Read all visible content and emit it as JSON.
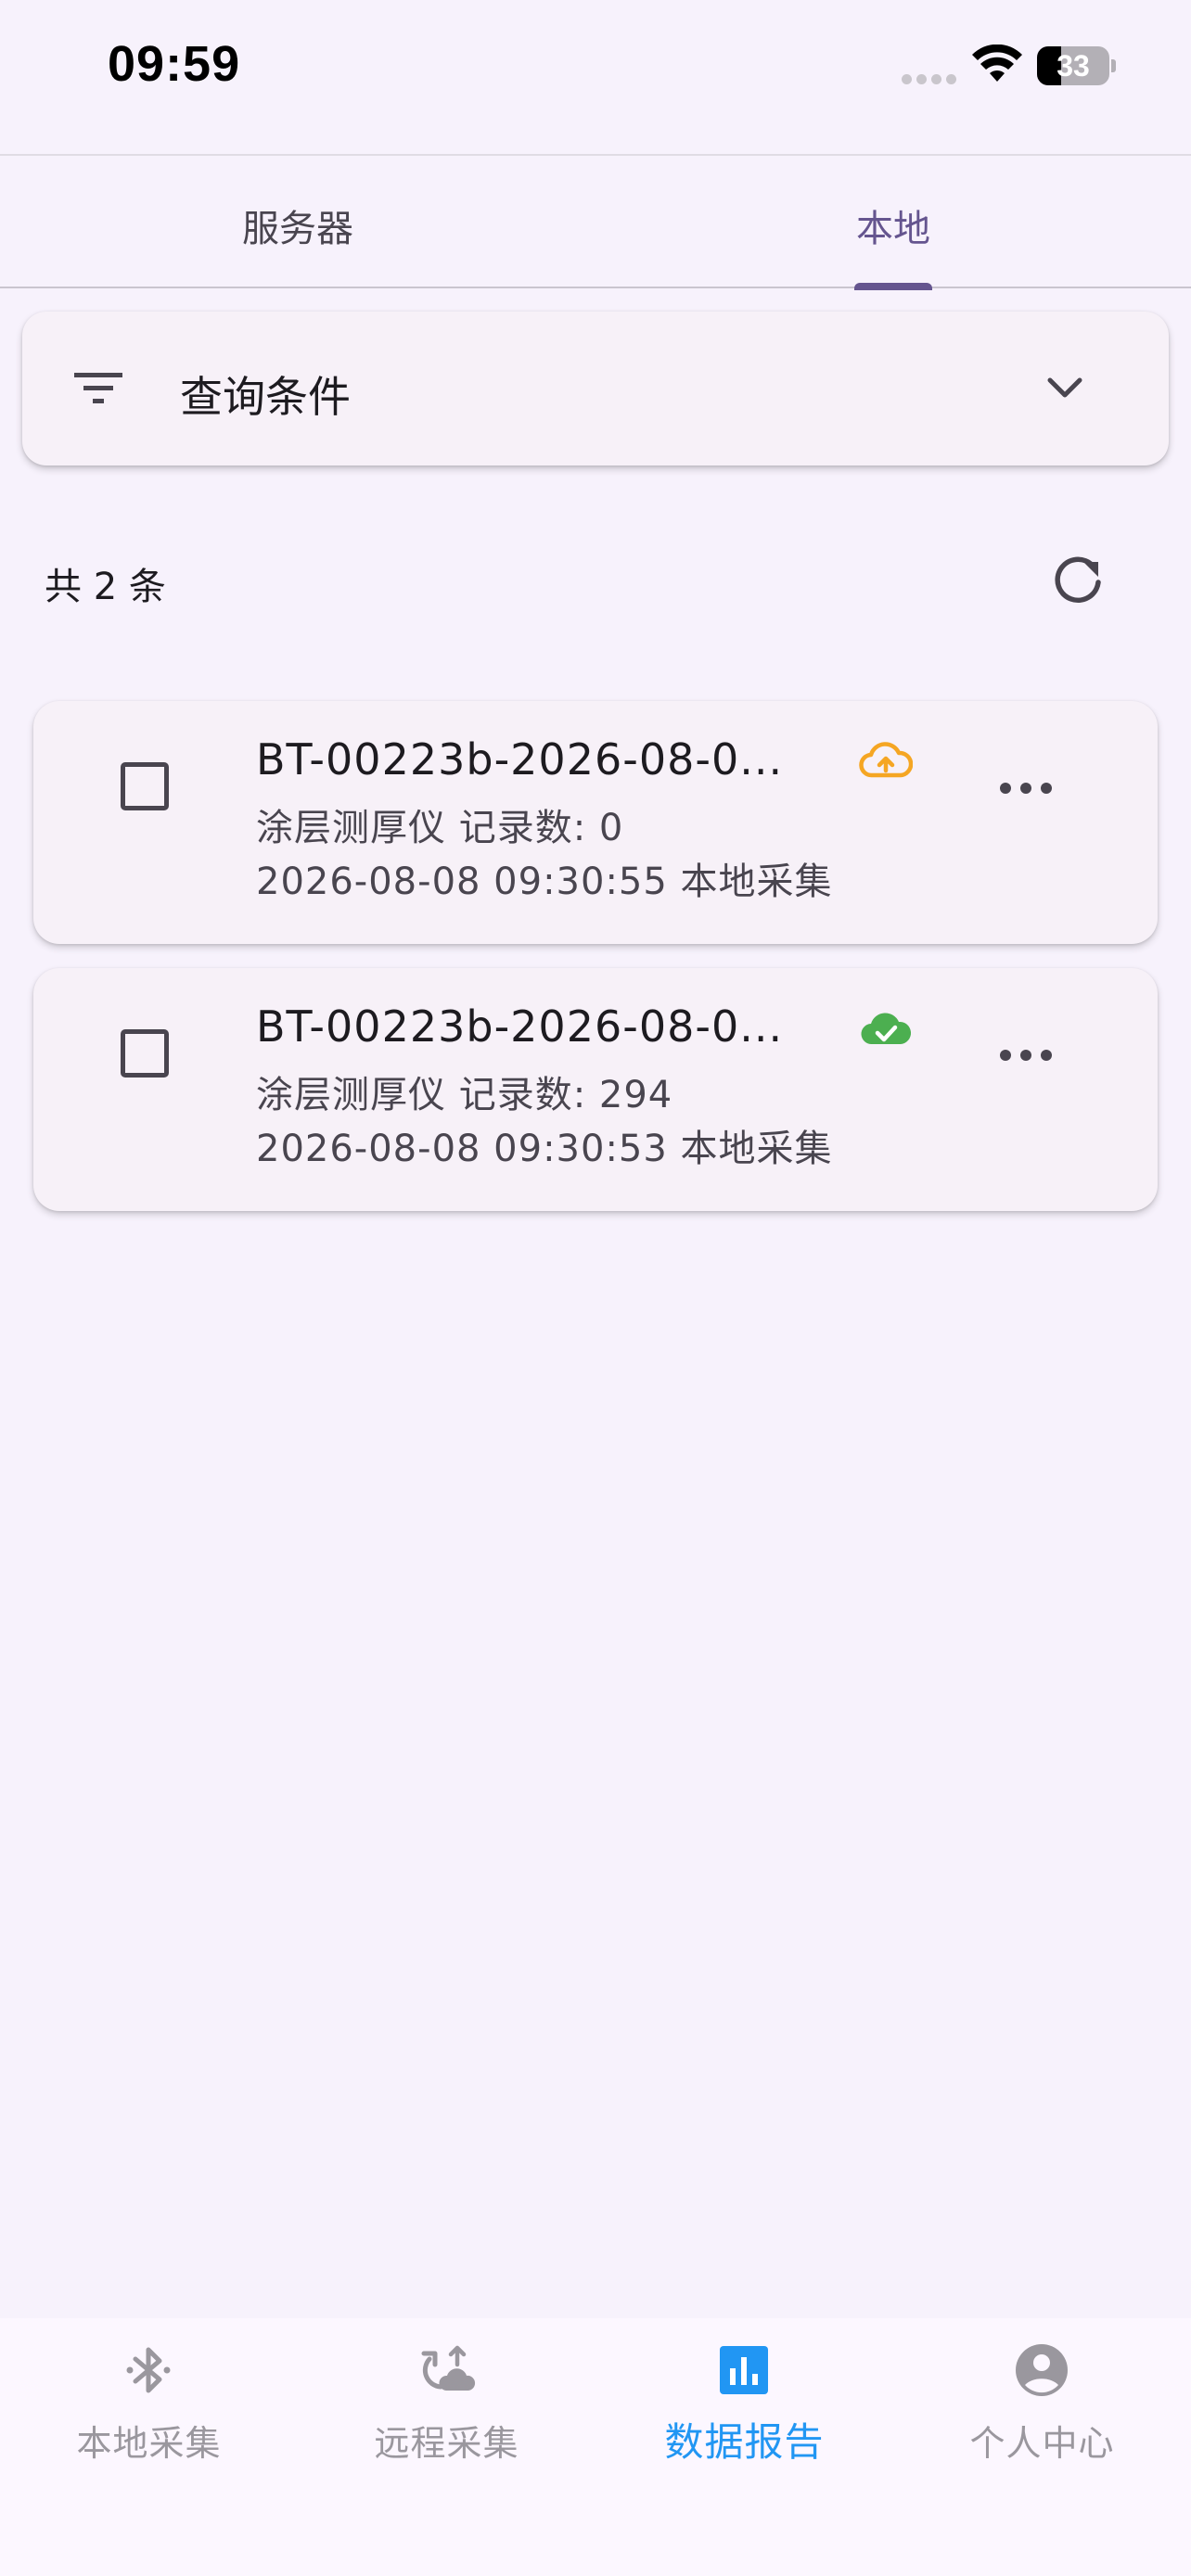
{
  "status_bar": {
    "time": "09:59",
    "battery_level": "33",
    "battery_fraction": 0.33
  },
  "tabs": [
    {
      "label": "服务器",
      "active": false
    },
    {
      "label": "本地",
      "active": true
    }
  ],
  "filter": {
    "label": "查询条件",
    "icon": "filter-list-icon",
    "expand_icon": "chevron-down-icon"
  },
  "summary": {
    "count_text": "共 2 条",
    "refresh_icon": "refresh-icon"
  },
  "records": [
    {
      "title": "BT-00223b-2026-08-0...",
      "sync_status": "pending-upload",
      "sync_icon": "cloud-upload-icon",
      "sync_color": "#f5a623",
      "device_line": "涂层测厚仪  记录数: 0",
      "time_line": "2026-08-08 09:30:55  本地采集"
    },
    {
      "title": "BT-00223b-2026-08-0...",
      "sync_status": "uploaded",
      "sync_icon": "cloud-done-icon",
      "sync_color": "#4caf50",
      "device_line": "涂层测厚仪  记录数: 294",
      "time_line": "2026-08-08 09:30:53  本地采集"
    }
  ],
  "bottom_nav": [
    {
      "label": "本地采集",
      "icon": "bluetooth-icon",
      "active": false
    },
    {
      "label": "远程采集",
      "icon": "cloud-sync-icon",
      "active": false
    },
    {
      "label": "数据报告",
      "icon": "bar-chart-icon",
      "active": true
    },
    {
      "label": "个人中心",
      "icon": "account-circle-icon",
      "active": false
    }
  ],
  "colors": {
    "background": "#f7f2fc",
    "accent_tab": "#65558f",
    "accent_nav": "#2196f3",
    "inactive_nav": "#9a979e"
  }
}
